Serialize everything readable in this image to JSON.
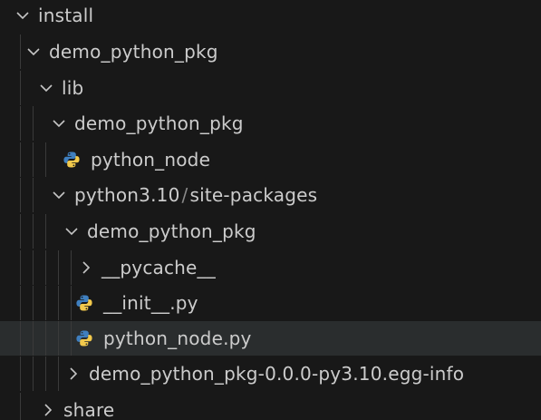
{
  "explorer": {
    "rows": [
      {
        "label": "install",
        "kind": "folder",
        "state": "expanded",
        "icon": "chevron-down-icon"
      },
      {
        "label": "demo_python_pkg",
        "kind": "folder",
        "state": "expanded",
        "icon": "chevron-down-icon"
      },
      {
        "label": "lib",
        "kind": "folder",
        "state": "expanded",
        "icon": "chevron-down-icon"
      },
      {
        "label": "demo_python_pkg",
        "kind": "folder",
        "state": "expanded",
        "icon": "chevron-down-icon"
      },
      {
        "label": "python_node",
        "kind": "file",
        "icon": "python-icon"
      },
      {
        "label_parts": [
          "python3.10",
          "/",
          "site-packages"
        ],
        "kind": "folder",
        "state": "expanded",
        "icon": "chevron-down-icon"
      },
      {
        "label": "demo_python_pkg",
        "kind": "folder",
        "state": "expanded",
        "icon": "chevron-down-icon"
      },
      {
        "label": "__pycache__",
        "kind": "folder",
        "state": "collapsed",
        "icon": "chevron-right-icon"
      },
      {
        "label": "__init__.py",
        "kind": "file",
        "icon": "python-icon"
      },
      {
        "label": "python_node.py",
        "kind": "file",
        "icon": "python-icon",
        "selected": true
      },
      {
        "label": "demo_python_pkg-0.0.0-py3.10.egg-info",
        "kind": "folder",
        "state": "collapsed",
        "icon": "chevron-right-icon"
      },
      {
        "label": "share",
        "kind": "folder",
        "state": "collapsed",
        "icon": "chevron-right-icon"
      }
    ]
  },
  "colors": {
    "background": "#181818",
    "text": "#cccccc",
    "selected_row": "#2a2d2e",
    "python_blue": "#3f7fbf",
    "python_yellow": "#f2c94c"
  }
}
